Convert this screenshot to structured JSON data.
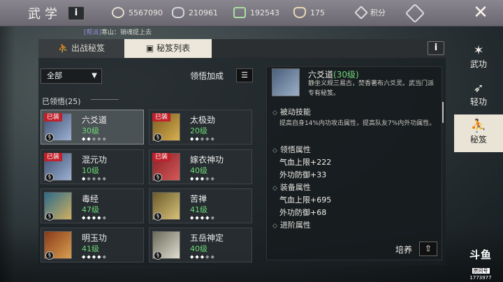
{
  "header": {
    "title": "武学",
    "info_label": "i",
    "resources": [
      {
        "icon": "coin-icon",
        "value": "5567090"
      },
      {
        "icon": "silver-icon",
        "value": "210961"
      },
      {
        "icon": "jade-icon",
        "value": "192543"
      },
      {
        "icon": "bowl-icon",
        "value": "175"
      }
    ],
    "points_label": "积分",
    "close_label": "✕"
  },
  "notice": {
    "tag": "[帮派]",
    "text": "寒山：销魂提上去"
  },
  "tabs": [
    {
      "label": "出战秘笈",
      "icon": "meditate-icon"
    },
    {
      "label": "秘笈列表",
      "icon": "book-icon"
    }
  ],
  "panel_info_label": "i",
  "filter": {
    "value": "全部",
    "icon": "filter-icon"
  },
  "bonus_label": "领悟加成",
  "learned_label": "已领悟(25)",
  "equip_tag": "已装",
  "skills": [
    {
      "name": "六爻道",
      "level": "30级",
      "equipped": true,
      "stars": 2,
      "max_stars": 5,
      "selected": true,
      "colors": [
        "#3d4d6e",
        "#9db2d4"
      ]
    },
    {
      "name": "太极劲",
      "level": "20级",
      "equipped": true,
      "stars": 2,
      "max_stars": 5,
      "selected": false,
      "colors": [
        "#7a5a20",
        "#d8b050"
      ]
    },
    {
      "name": "混元功",
      "level": "10级",
      "equipped": true,
      "stars": 1,
      "max_stars": 5,
      "selected": false,
      "colors": [
        "#3d4d6e",
        "#9db2d4"
      ]
    },
    {
      "name": "嫁衣神功",
      "level": "40级",
      "equipped": true,
      "stars": 3,
      "max_stars": 5,
      "selected": false,
      "colors": [
        "#8a1e24",
        "#d45a5a"
      ]
    },
    {
      "name": "毒经",
      "level": "47级",
      "equipped": false,
      "stars": 4,
      "max_stars": 5,
      "selected": false,
      "colors": [
        "#2b6a8a",
        "#d0b060"
      ]
    },
    {
      "name": "苦禅",
      "level": "41级",
      "equipped": false,
      "stars": 4,
      "max_stars": 5,
      "selected": false,
      "colors": [
        "#6a5a2a",
        "#d8c27a"
      ]
    },
    {
      "name": "明玉功",
      "level": "41级",
      "equipped": false,
      "stars": 4,
      "max_stars": 5,
      "selected": false,
      "colors": [
        "#8a3a1a",
        "#d8a050"
      ]
    },
    {
      "name": "五岳神定",
      "level": "40级",
      "equipped": false,
      "stars": 3,
      "max_stars": 5,
      "selected": false,
      "colors": [
        "#6a6a5a",
        "#e0ddd0"
      ]
    }
  ],
  "detail": {
    "name": "六爻道",
    "level": "(30级)",
    "description": "静坐义规三易古，焚香著布六爻灵。武当门派专有秘笈。",
    "passive_title": "被动技能",
    "passive_text": "提高自身14%内功攻击属性，提高队友7%内外功属性。",
    "insight_title": "领悟属性",
    "insight_stats": [
      "气血上限+222",
      "外功防御+33"
    ],
    "equip_title": "装备属性",
    "equip_stats": [
      "气血上限+695",
      "外功防御+68"
    ],
    "advance_title": "进阶属性",
    "cultivate_label": "培养",
    "cultivate_icon": "up-arrow-icon"
  },
  "side_nav": [
    {
      "label": "武功",
      "icon": "martial-icon",
      "active": false
    },
    {
      "label": "轻功",
      "icon": "flight-icon",
      "active": false
    },
    {
      "label": "秘笈",
      "icon": "meditate-icon",
      "active": true
    }
  ],
  "watermark": {
    "brand": "斗鱼",
    "room_label": "房间号",
    "room_id": "1773977"
  }
}
